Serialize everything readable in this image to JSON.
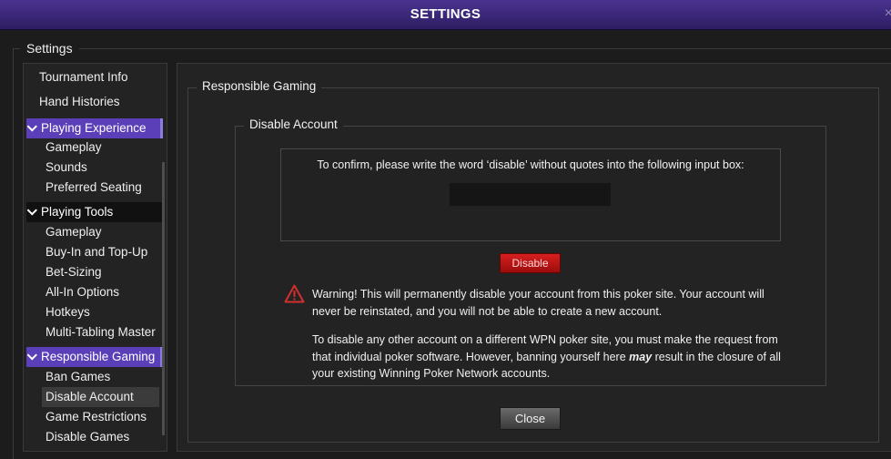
{
  "window": {
    "title": "SETTINGS",
    "close_glyph": "×"
  },
  "settings_group": {
    "label": "Settings"
  },
  "sidebar": {
    "top_items": [
      {
        "label": "Tournament Info"
      },
      {
        "label": "Hand Histories"
      }
    ],
    "sections": [
      {
        "label": "Playing Experience",
        "expanded": true,
        "active": true,
        "items": [
          {
            "label": "Gameplay"
          },
          {
            "label": "Sounds"
          },
          {
            "label": "Preferred Seating"
          }
        ]
      },
      {
        "label": "Playing Tools",
        "expanded": true,
        "active": false,
        "items": [
          {
            "label": "Gameplay"
          },
          {
            "label": "Buy-In and Top-Up"
          },
          {
            "label": "Bet-Sizing"
          },
          {
            "label": "All-In Options"
          },
          {
            "label": "Hotkeys"
          },
          {
            "label": "Multi-Tabling Master"
          }
        ]
      },
      {
        "label": "Responsible Gaming",
        "expanded": true,
        "active": true,
        "items": [
          {
            "label": "Ban Games"
          },
          {
            "label": "Disable Account",
            "selected": true
          },
          {
            "label": "Game Restrictions"
          },
          {
            "label": "Disable Games"
          }
        ]
      }
    ]
  },
  "main": {
    "group_title": "Responsible Gaming",
    "subgroup_title": "Disable Account",
    "confirm_prompt": "To confirm, please write the word ‘disable’ without quotes into the following input box:",
    "confirm_input_value": "",
    "disable_button_label": "Disable",
    "warning_text": "Warning! This will permanently disable your account from this poker site. Your account will never be reinstated, and you will not be able to create a new account.",
    "info_text_before": "To disable any other account on a different WPN poker site, you must make the request from that individual poker software. However, banning yourself here ",
    "info_text_emphasis": "may",
    "info_text_after": " result in the closure of all your existing Winning Poker Network accounts.",
    "close_button_label": "Close"
  },
  "colors": {
    "titlebar": "#3d2a80",
    "section_active": "#5a3fb8",
    "disable_button": "#c41818",
    "warning_icon": "#d32f2f"
  }
}
